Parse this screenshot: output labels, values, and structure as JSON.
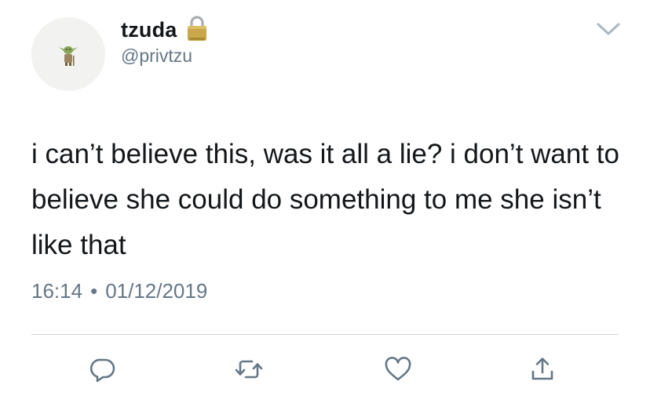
{
  "tweet": {
    "display_name": "tzuda",
    "handle": "@privtzu",
    "protected_icon": "lock-icon",
    "text": "i can’t believe this, was it all a lie? i don’t want to believe she could do something to me she isn’t like that",
    "time": "16:14",
    "separator": "•",
    "date": "01/12/2019"
  },
  "actions": {
    "reply_icon": "reply-icon",
    "retweet_icon": "retweet-icon",
    "like_icon": "heart-icon",
    "share_icon": "share-icon"
  },
  "colors": {
    "text": "#14171a",
    "secondary": "#657786",
    "icon": "#657786",
    "divider": "#cfd6dc",
    "avatar_bg": "#f2f2f0",
    "lock_gold": "#c9a74a"
  }
}
